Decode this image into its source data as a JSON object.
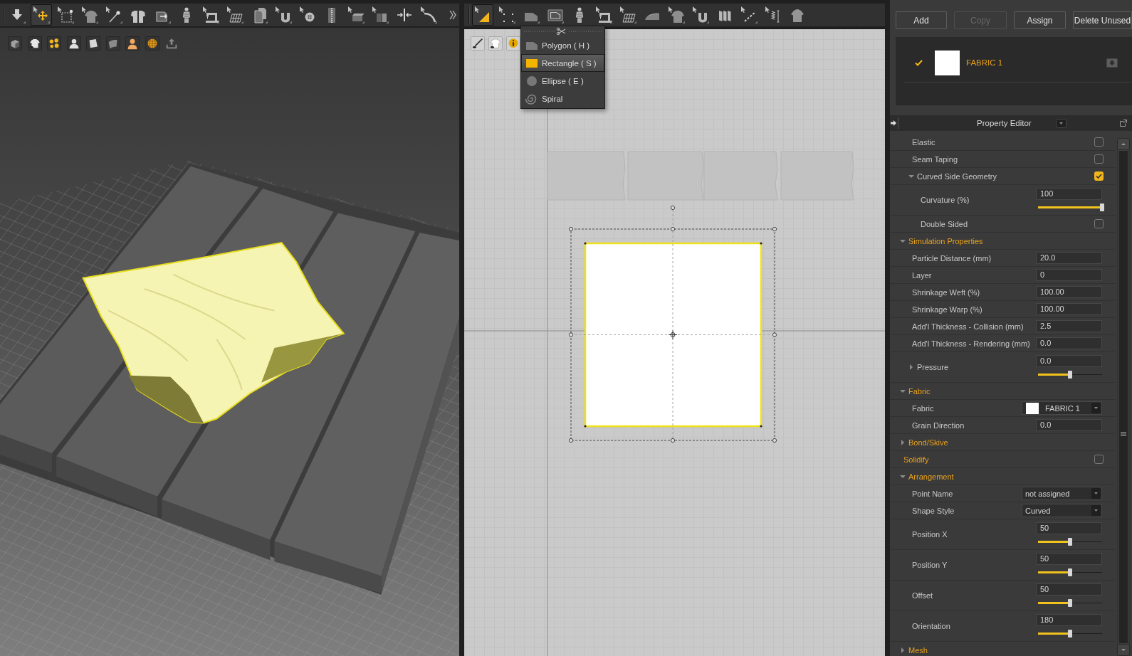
{
  "viewport_3d": {
    "toolbar": [
      {
        "kind": "drop",
        "selected": false
      },
      {
        "kind": "move",
        "selected": true
      },
      {
        "kind": "transform",
        "selected": false
      },
      {
        "kind": "garment",
        "selected": false
      },
      {
        "kind": "pin",
        "selected": false
      },
      {
        "kind": "pieces",
        "selected": false
      },
      {
        "kind": "tray",
        "selected": false
      },
      {
        "kind": "figure",
        "selected": false
      },
      {
        "kind": "sewing",
        "selected": false
      },
      {
        "kind": "grid",
        "selected": false
      },
      {
        "kind": "pages",
        "selected": false
      },
      {
        "kind": "tack",
        "selected": false
      },
      {
        "kind": "coatbutton",
        "selected": false
      },
      {
        "kind": "zipper",
        "selected": false
      },
      {
        "kind": "block",
        "selected": false
      },
      {
        "kind": "blocks",
        "selected": false
      },
      {
        "kind": "arrowsin",
        "selected": false
      },
      {
        "kind": "measure",
        "selected": false
      }
    ],
    "display_icons": [
      {
        "kind": "cube"
      },
      {
        "kind": "shirteye"
      },
      {
        "kind": "dots"
      },
      {
        "kind": "person"
      },
      {
        "kind": "fabric"
      },
      {
        "kind": "fabricdark"
      },
      {
        "kind": "skin"
      },
      {
        "kind": "globe"
      },
      {
        "kind": "upload"
      }
    ]
  },
  "pattern_window": {
    "toolbar": [
      {
        "kind": "triangle",
        "selected": true
      },
      {
        "kind": "points",
        "selected": false
      },
      {
        "kind": "polygon",
        "selected": false
      },
      {
        "kind": "frame",
        "selected": false
      },
      {
        "kind": "figure",
        "selected": false
      },
      {
        "kind": "sewing",
        "selected": false
      },
      {
        "kind": "grid",
        "selected": false
      },
      {
        "kind": "iron",
        "selected": false
      },
      {
        "kind": "garment",
        "selected": false
      },
      {
        "kind": "tack",
        "selected": false
      },
      {
        "kind": "stripes",
        "selected": false
      },
      {
        "kind": "dash",
        "selected": false
      },
      {
        "kind": "spring",
        "selected": false
      },
      {
        "kind": "shirt",
        "selected": false
      }
    ],
    "canvas_icons": [
      {
        "kind": "needle"
      },
      {
        "kind": "shirt"
      },
      {
        "kind": "info"
      }
    ],
    "shape_menu": [
      {
        "kind": "polygon",
        "label": "Polygon ( H )",
        "selected": false
      },
      {
        "kind": "rectangle",
        "label": "Rectangle ( S )",
        "selected": true
      },
      {
        "kind": "ellipse",
        "label": "Ellipse ( E )",
        "selected": false
      },
      {
        "kind": "spiral",
        "label": "Spiral",
        "selected": false
      }
    ]
  },
  "object_browser": {
    "buttons": [
      {
        "label": "Add",
        "disabled": false
      },
      {
        "label": "Copy",
        "disabled": true
      },
      {
        "label": "Assign",
        "disabled": false
      },
      {
        "label": "Delete Unused",
        "disabled": false
      }
    ],
    "fabrics": [
      {
        "name": "FABRIC 1",
        "selected": true,
        "color": "#ffffff"
      }
    ]
  },
  "property_editor": {
    "title": "Property Editor",
    "properties": [
      {
        "kind": "checkbox",
        "label": "Elastic",
        "checked": false
      },
      {
        "kind": "checkbox",
        "label": "Seam Taping",
        "checked": false
      },
      {
        "kind": "checkbox",
        "label": "Curved Side Geometry",
        "checked": true,
        "expanded": true,
        "children": [
          {
            "kind": "slider",
            "label": "Curvature (%)",
            "value": "100",
            "level": 1
          },
          {
            "kind": "checkbox",
            "label": "Double Sided",
            "checked": false
          }
        ]
      },
      {
        "kind": "section",
        "label": "Simulation Properties",
        "expanded": true,
        "children": [
          {
            "kind": "input",
            "label": "Particle Distance (mm)",
            "value": "20.0"
          },
          {
            "kind": "input",
            "label": "Layer",
            "value": "0"
          },
          {
            "kind": "input",
            "label": "Shrinkage Weft (%)",
            "value": "100.00"
          },
          {
            "kind": "input",
            "label": "Shrinkage Warp (%)",
            "value": "100.00"
          },
          {
            "kind": "input",
            "label": "Add'l Thickness - Collision (mm)",
            "value": "2.5"
          },
          {
            "kind": "input",
            "label": "Add'l Thickness - Rendering (mm)",
            "value": "0.0"
          },
          {
            "kind": "slider",
            "label": "Pressure",
            "value": "0.0",
            "level": 0.5,
            "expanded": false
          }
        ]
      },
      {
        "kind": "section",
        "label": "Fabric",
        "expanded": true,
        "children": [
          {
            "kind": "swatch",
            "label": "Fabric",
            "value": "FABRIC 1",
            "color": "#ffffff"
          },
          {
            "kind": "input",
            "label": "Grain Direction",
            "value": "0.0"
          }
        ]
      },
      {
        "kind": "section",
        "label": "Bond/Skive",
        "expanded": false
      },
      {
        "kind": "section",
        "label": "Solidify",
        "checked": false
      },
      {
        "kind": "section",
        "label": "Arrangement",
        "expanded": true,
        "children": [
          {
            "kind": "dropdown",
            "label": "Point Name",
            "value": "not assigned"
          },
          {
            "kind": "dropdown",
            "label": "Shape Style",
            "value": "Curved"
          },
          {
            "kind": "slider",
            "label": "Position X",
            "value": "50",
            "level": 0.5
          },
          {
            "kind": "slider",
            "label": "Position Y",
            "value": "50",
            "level": 0.5
          },
          {
            "kind": "slider",
            "label": "Offset",
            "value": "50",
            "level": 0.5
          },
          {
            "kind": "slider",
            "label": "Orientation",
            "value": "180",
            "level": 0.5
          }
        ]
      },
      {
        "kind": "section",
        "label": "Mesh",
        "expanded": false
      }
    ]
  }
}
